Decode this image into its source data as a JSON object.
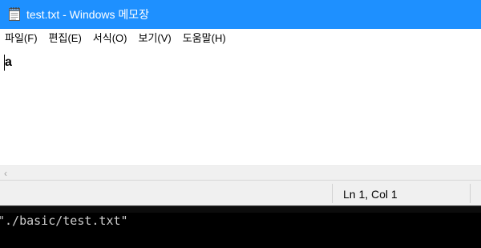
{
  "window": {
    "title": "test.txt - Windows 메모장",
    "icon": "notepad-icon",
    "accent_color": "#1e90ff"
  },
  "menu": {
    "items": [
      {
        "label": "파일(F)"
      },
      {
        "label": "편집(E)"
      },
      {
        "label": "서식(O)"
      },
      {
        "label": "보기(V)"
      },
      {
        "label": "도움말(H)"
      }
    ]
  },
  "editor": {
    "content": "a"
  },
  "status": {
    "position": "Ln 1, Col 1"
  },
  "console": {
    "text": "\"./basic/test.txt\""
  }
}
